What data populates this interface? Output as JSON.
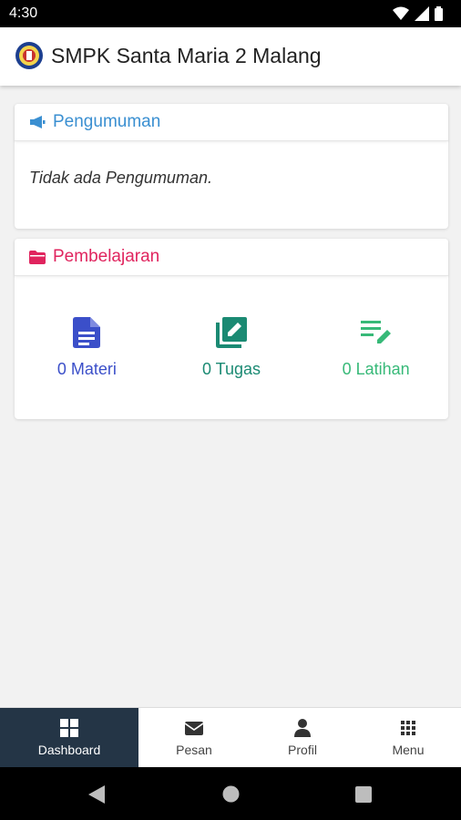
{
  "status_bar": {
    "time": "4:30"
  },
  "app_bar": {
    "title": "SMPK Santa Maria 2 Malang"
  },
  "announcement": {
    "title": "Pengumuman",
    "message": "Tidak ada Pengumuman."
  },
  "learning": {
    "title": "Pembelajaran",
    "items": [
      {
        "label": "0 Materi",
        "icon": "document-icon",
        "color": "#3b4fc9"
      },
      {
        "label": "0 Tugas",
        "icon": "edit-assignment-icon",
        "color": "#1b8a73"
      },
      {
        "label": "0 Latihan",
        "icon": "list-edit-icon",
        "color": "#37b978"
      }
    ]
  },
  "bottom_nav": {
    "items": [
      {
        "label": "Dashboard",
        "icon": "grid-icon",
        "active": true
      },
      {
        "label": "Pesan",
        "icon": "envelope-icon"
      },
      {
        "label": "Profil",
        "icon": "person-icon"
      },
      {
        "label": "Menu",
        "icon": "apps-icon"
      }
    ]
  },
  "colors": {
    "announcement_accent": "#3a8fd1",
    "learning_accent": "#e0245e",
    "nav_active_bg": "#243546"
  }
}
